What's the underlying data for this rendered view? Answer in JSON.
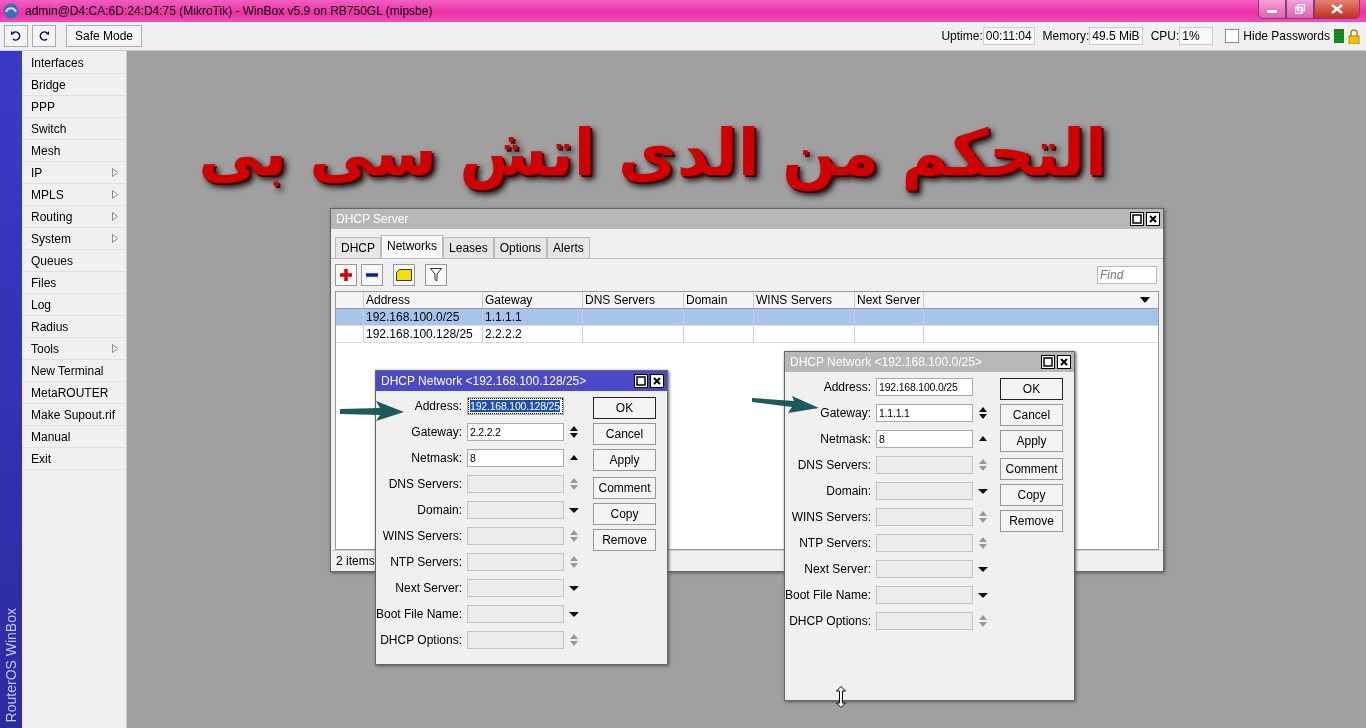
{
  "window": {
    "title": "admin@D4:CA:6D:24:D4:75 (MikroTik) - WinBox v5.9 on RB750GL (mipsbe)"
  },
  "toolbar": {
    "safe_mode": "Safe Mode",
    "uptime_label": "Uptime:",
    "uptime": "00:11:04",
    "memory_label": "Memory:",
    "memory": "49.5 MiB",
    "cpu_label": "CPU:",
    "cpu": "1%",
    "hide_passwords": {
      "label": "Hide Passwords",
      "checked": false
    }
  },
  "sidebar": {
    "brand": "RouterOS WinBox",
    "items": [
      {
        "label": "Interfaces",
        "submenu": false
      },
      {
        "label": "Bridge",
        "submenu": false
      },
      {
        "label": "PPP",
        "submenu": false
      },
      {
        "label": "Switch",
        "submenu": false
      },
      {
        "label": "Mesh",
        "submenu": false
      },
      {
        "label": "IP",
        "submenu": true
      },
      {
        "label": "MPLS",
        "submenu": true
      },
      {
        "label": "Routing",
        "submenu": true
      },
      {
        "label": "System",
        "submenu": true
      },
      {
        "label": "Queues",
        "submenu": false
      },
      {
        "label": "Files",
        "submenu": false
      },
      {
        "label": "Log",
        "submenu": false
      },
      {
        "label": "Radius",
        "submenu": false
      },
      {
        "label": "Tools",
        "submenu": true
      },
      {
        "label": "New Terminal",
        "submenu": false
      },
      {
        "label": "MetaROUTER",
        "submenu": false
      },
      {
        "label": "Make Supout.rif",
        "submenu": false
      },
      {
        "label": "Manual",
        "submenu": false
      },
      {
        "label": "Exit",
        "submenu": false
      }
    ]
  },
  "caption": "التحكم من الدى اتش سى بى",
  "dhcp_server": {
    "title": "DHCP Server",
    "active": false,
    "tabs": [
      {
        "label": "DHCP",
        "selected": false
      },
      {
        "label": "Networks",
        "selected": true
      },
      {
        "label": "Leases",
        "selected": false
      },
      {
        "label": "Options",
        "selected": false
      },
      {
        "label": "Alerts",
        "selected": false
      }
    ],
    "find": {
      "placeholder": "Find"
    },
    "columns": [
      "Address",
      "Gateway",
      "DNS Servers",
      "Domain",
      "WINS Servers",
      "Next Server"
    ],
    "rows": [
      {
        "cells": [
          "192.168.100.0/25",
          "1.1.1.1",
          "",
          "",
          "",
          ""
        ],
        "selected": true
      },
      {
        "cells": [
          "192.168.100.128/25",
          "2.2.2.2",
          "",
          "",
          "",
          ""
        ],
        "selected": false
      }
    ],
    "status": "2 items"
  },
  "dialogs": [
    {
      "title": "DHCP Network <192.168.100.128/25>",
      "active": true,
      "fields": [
        {
          "label": "Address:",
          "value": "192.168.100.128/25",
          "enabled": true,
          "selected": true,
          "kind": "none"
        },
        {
          "label": "Gateway:",
          "value": "2.2.2.2",
          "enabled": true,
          "selected": false,
          "kind": "updown"
        },
        {
          "label": "Netmask:",
          "value": "8",
          "enabled": true,
          "selected": false,
          "kind": "up"
        },
        {
          "label": "DNS Servers:",
          "enabled": false,
          "selected": false,
          "kind": "updown"
        },
        {
          "label": "Domain:",
          "enabled": false,
          "selected": false,
          "kind": "down"
        },
        {
          "label": "WINS Servers:",
          "enabled": false,
          "selected": false,
          "kind": "updown"
        },
        {
          "label": "NTP Servers:",
          "enabled": false,
          "selected": false,
          "kind": "updown"
        },
        {
          "label": "Next Server:",
          "enabled": false,
          "selected": false,
          "kind": "down"
        },
        {
          "label": "Boot File Name:",
          "enabled": false,
          "selected": false,
          "kind": "down"
        },
        {
          "label": "DHCP Options:",
          "enabled": false,
          "selected": false,
          "kind": "updown"
        }
      ],
      "button_groups": [
        [
          "OK",
          "Cancel",
          "Apply"
        ],
        [
          "Comment",
          "Copy",
          "Remove"
        ]
      ]
    },
    {
      "title": "DHCP Network <192.168.100.0/25>",
      "active": false,
      "fields": [
        {
          "label": "Address:",
          "value": "192.168.100.0/25",
          "enabled": true,
          "selected": false,
          "kind": "none"
        },
        {
          "label": "Gateway:",
          "value": "1.1.1.1",
          "enabled": true,
          "selected": false,
          "kind": "updown"
        },
        {
          "label": "Netmask:",
          "value": "8",
          "enabled": true,
          "selected": false,
          "kind": "up"
        },
        {
          "label": "DNS Servers:",
          "enabled": false,
          "selected": false,
          "kind": "updown"
        },
        {
          "label": "Domain:",
          "enabled": false,
          "selected": false,
          "kind": "down"
        },
        {
          "label": "WINS Servers:",
          "enabled": false,
          "selected": false,
          "kind": "updown"
        },
        {
          "label": "NTP Servers:",
          "enabled": false,
          "selected": false,
          "kind": "updown"
        },
        {
          "label": "Next Server:",
          "enabled": false,
          "selected": false,
          "kind": "down"
        },
        {
          "label": "Boot File Name:",
          "enabled": false,
          "selected": false,
          "kind": "down"
        },
        {
          "label": "DHCP Options:",
          "enabled": false,
          "selected": false,
          "kind": "updown"
        }
      ],
      "button_groups": [
        [
          "OK",
          "Cancel",
          "Apply"
        ],
        [
          "Comment",
          "Copy",
          "Remove"
        ]
      ]
    }
  ]
}
